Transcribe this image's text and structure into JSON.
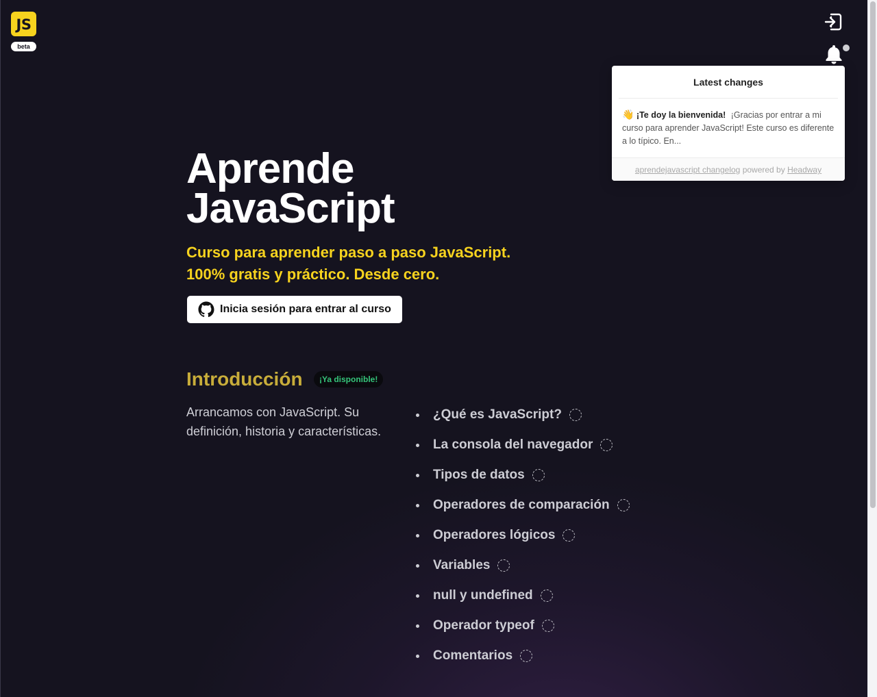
{
  "logo": {
    "text": "JS",
    "badge": "beta"
  },
  "icons": {
    "login": "login-icon",
    "notifications": "bell-icon",
    "github": "github-icon",
    "lesson_status": "dashed-circle-icon"
  },
  "changelog": {
    "title": "Latest changes",
    "entry_emoji": "👋",
    "entry_title": "¡Te doy la bienvenida!",
    "entry_text": "¡Gracias por entrar a mi curso para aprender JavaScript! Este curso es diferente a lo típico. En...",
    "footer_link": "aprendejavascript changelog",
    "footer_powered": "powered by",
    "footer_brand": "Headway"
  },
  "hero": {
    "title_line1": "Aprende",
    "title_line2": "JavaScript",
    "subtitle_line1": "Curso para aprender paso a paso JavaScript.",
    "subtitle_line2": "100% gratis y práctico. Desde cero.",
    "login_button": "Inicia sesión para entrar al curso"
  },
  "section": {
    "title": "Introducción",
    "badge": "¡Ya disponible!",
    "description": "Arrancamos con JavaScript. Su definición, historia y características.",
    "lessons": [
      "¿Qué es JavaScript?",
      "La consola del navegador",
      "Tipos de datos",
      "Operadores de comparación",
      "Operadores lógicos",
      "Variables",
      "null y undefined",
      "Operador typeof",
      "Comentarios"
    ]
  },
  "colors": {
    "background": "#15131f",
    "accent_yellow": "#f7d31e",
    "section_gold": "#c8ad3a",
    "badge_green": "#35c47a"
  }
}
